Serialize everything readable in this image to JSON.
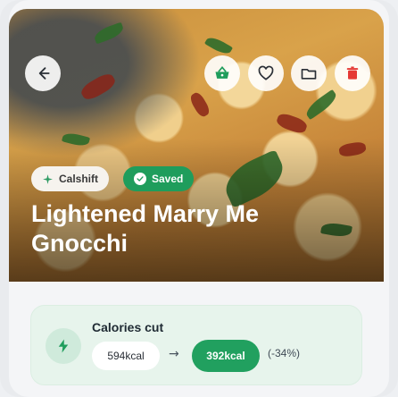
{
  "hero": {
    "brand_chip": "Calshift",
    "saved_chip": "Saved",
    "title": "Lightened Marry Me Gnocchi"
  },
  "actions": {
    "back_icon": "arrow-left-icon",
    "basket_icon": "basket-icon",
    "heart_icon": "heart-icon",
    "folder_icon": "folder-icon",
    "delete_icon": "trash-icon"
  },
  "calories": {
    "label": "Calories cut",
    "before": "594kcal",
    "arrow": "→",
    "after": "392kcal",
    "change": "(-34%)"
  },
  "colors": {
    "accent_green": "#21a05f",
    "delete_red": "#e53935",
    "panel_bg": "#e7f4ec"
  }
}
